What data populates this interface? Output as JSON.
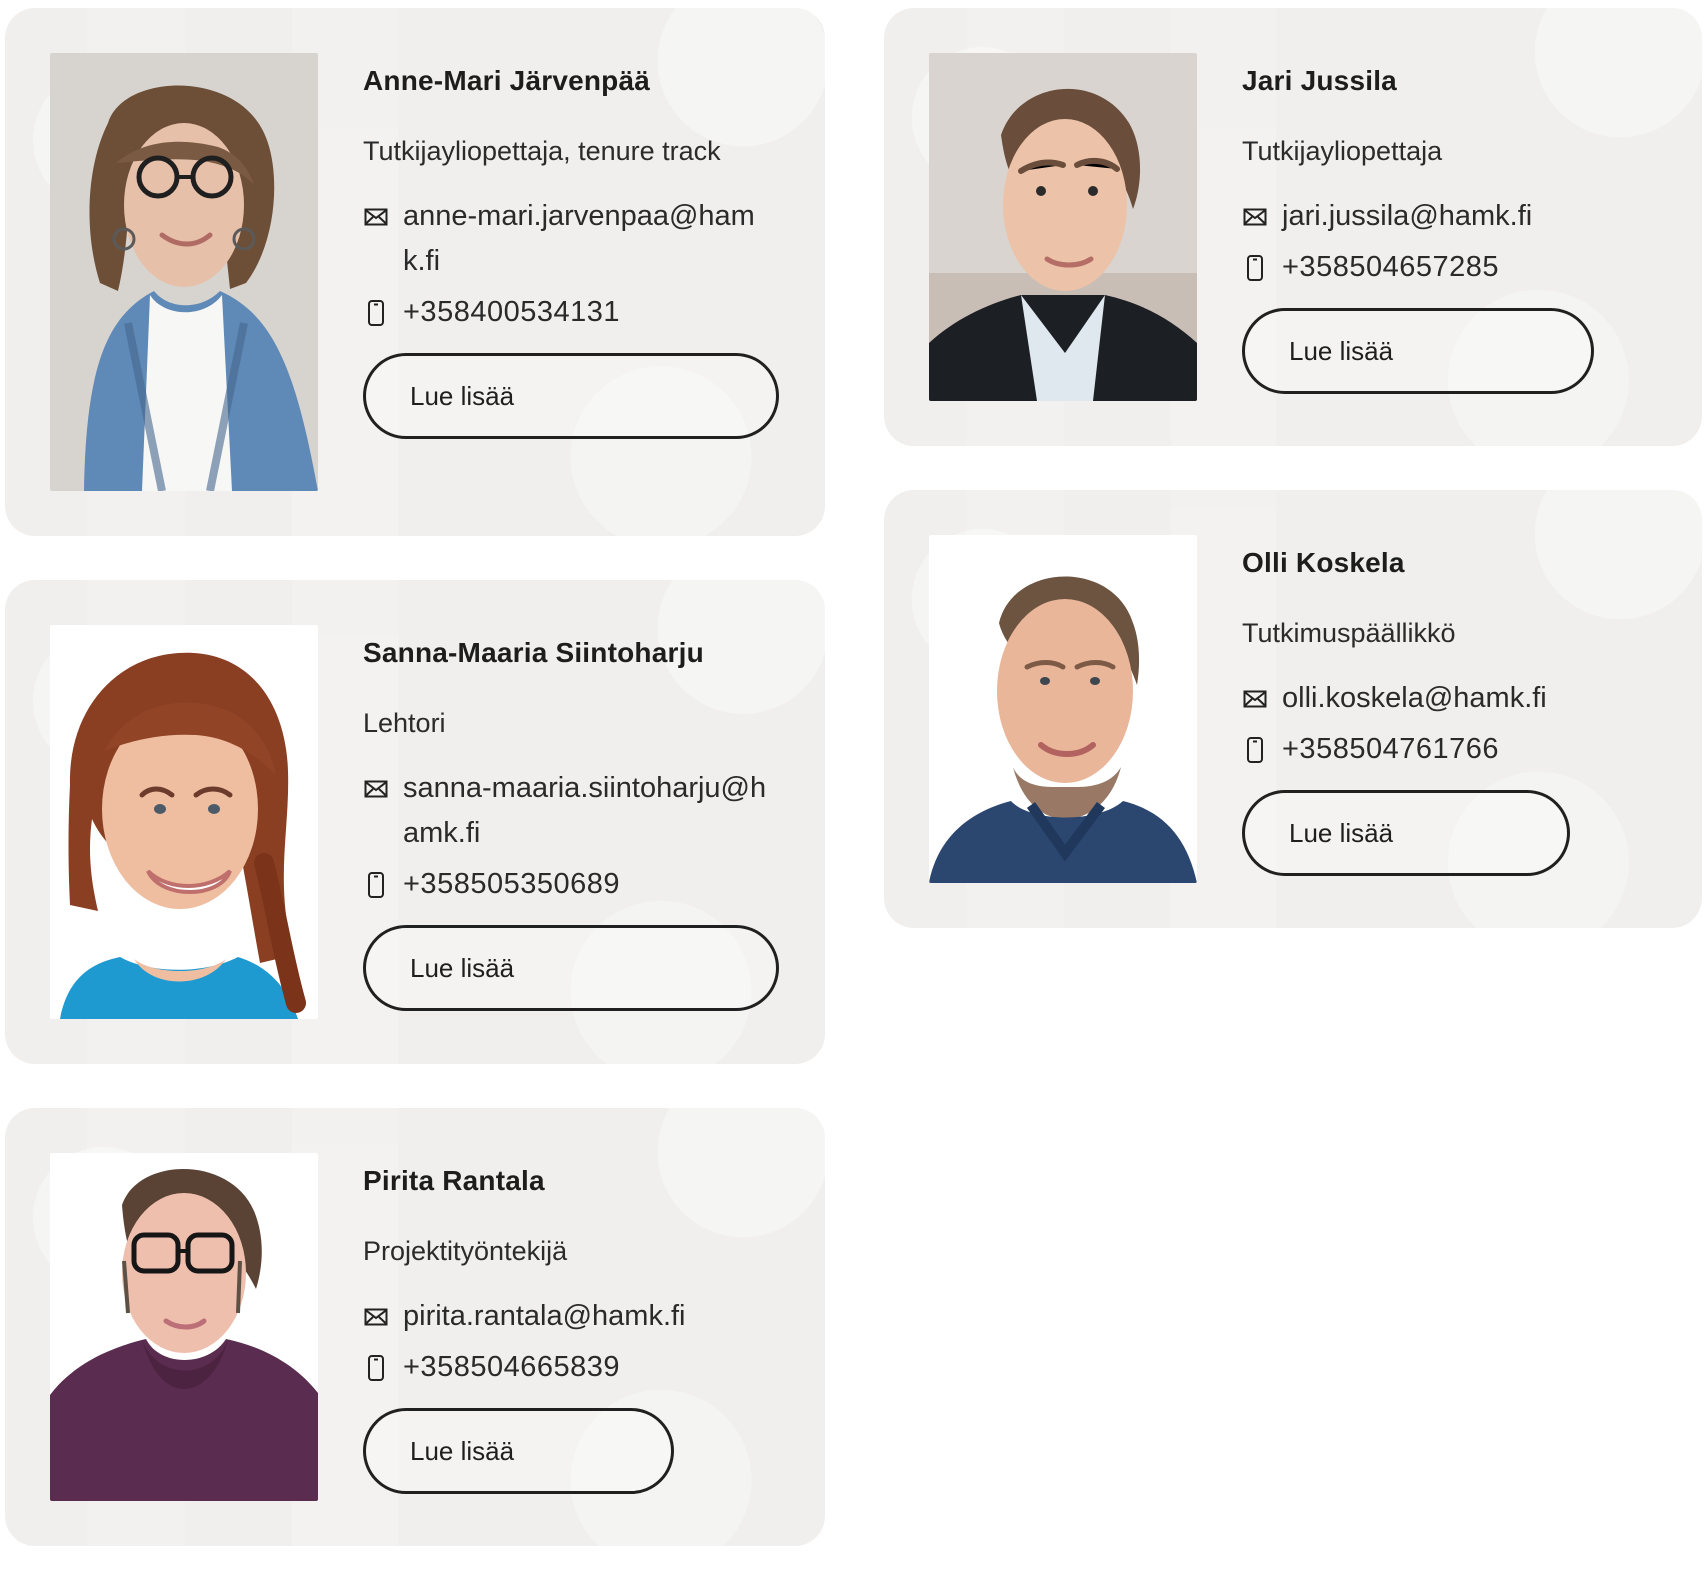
{
  "people": [
    {
      "name": "Anne-Mari Järvenpää",
      "title": "Tutkijayliopettaja, tenure track",
      "email": "anne-mari.jarvenpaa@hamk.fi",
      "phone": "+358400534131",
      "button": "Lue lisää"
    },
    {
      "name": "Jari Jussila",
      "title": "Tutkijayliopettaja",
      "email": "jari.jussila@hamk.fi",
      "phone": "+358504657285",
      "button": "Lue lisää"
    },
    {
      "name": "Sanna-Maaria Siintoharju",
      "title": "Lehtori",
      "email": "sanna-maaria.siintoharju@hamk.fi",
      "phone": "+358505350689",
      "button": "Lue lisää"
    },
    {
      "name": "Olli Koskela",
      "title": "Tutkimuspäällikkö",
      "email": "olli.koskela@hamk.fi",
      "phone": "+358504761766",
      "button": "Lue lisää"
    },
    {
      "name": "Pirita Rantala",
      "title": "Projektityöntekijä",
      "email": "pirita.rantala@hamk.fi",
      "phone": "+358504665839",
      "button": "Lue lisää"
    }
  ],
  "icons": {
    "email": "envelope-icon",
    "phone": "mobile-phone-icon"
  },
  "colors": {
    "card_background": "#f0efed",
    "text": "#1d1d1b",
    "button_border": "#202020",
    "page_background": "#ffffff"
  }
}
